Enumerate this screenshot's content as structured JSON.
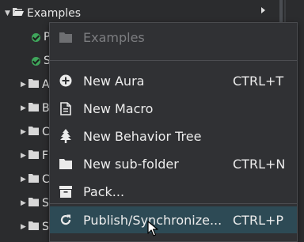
{
  "tree": {
    "root": {
      "label": "Examples"
    },
    "children": [
      {
        "label": "P",
        "status": "check"
      },
      {
        "label": "S",
        "status": "check"
      },
      {
        "label": "A",
        "kind": "folder"
      },
      {
        "label": "B",
        "kind": "folder"
      },
      {
        "label": "C",
        "kind": "folder"
      },
      {
        "label": "F",
        "kind": "folder"
      },
      {
        "label": "C",
        "kind": "folder"
      },
      {
        "label": "S",
        "kind": "folder"
      },
      {
        "label": "S",
        "kind": "folder"
      }
    ]
  },
  "menu": {
    "header": "Examples",
    "items": [
      {
        "label": "New Aura",
        "shortcut": "CTRL+T",
        "icon": "plus-circle-icon"
      },
      {
        "label": "New Macro",
        "shortcut": "",
        "icon": "document-icon"
      },
      {
        "label": "New Behavior Tree",
        "shortcut": "",
        "icon": "tree-icon"
      },
      {
        "label": "New sub-folder",
        "shortcut": "CTRL+N",
        "icon": "folder-icon"
      },
      {
        "label": "Pack...",
        "shortcut": "",
        "icon": "archive-box-icon"
      },
      {
        "label": "Publish/Synchronize...",
        "shortcut": "CTRL+P",
        "icon": "sync-icon"
      }
    ]
  },
  "colors": {
    "background": "#2b2c2e",
    "menu_background": "#303134",
    "hover": "#2d4a55",
    "status_ok": "#3fa65b",
    "text": "#ececec",
    "disabled_text": "#7c7d80"
  }
}
